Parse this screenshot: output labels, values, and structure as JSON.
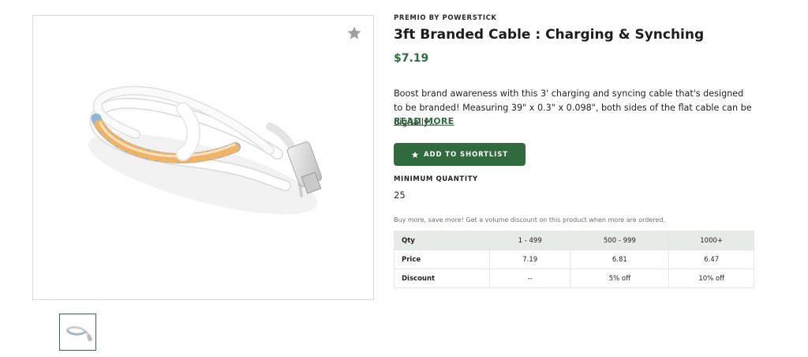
{
  "product": {
    "brand": "PREMIO BY POWERSTICK",
    "title": "3ft Branded Cable : Charging & Synching",
    "price": "$7.19",
    "description": "Boost brand awareness with this 3' charging and syncing cable that's designed to be branded! Measuring 39\" x 0.3\" x 0.098\", both sides of the flat cable can be digitally…",
    "read_more": "READ MORE",
    "shortlist_label": "ADD TO SHORTLIST",
    "min_qty_label": "MINIMUM QUANTITY",
    "min_qty_value": "25",
    "volume_note": "Buy more, save more! Get a volume discount on this product when more are ordered."
  },
  "pricing_table": {
    "headers": [
      "Qty",
      "1 - 499",
      "500 - 999",
      "1000+"
    ],
    "rows": [
      [
        "Price",
        "7.19",
        "6.81",
        "6.47"
      ],
      [
        "Discount",
        "--",
        "5% off",
        "10% off"
      ]
    ]
  },
  "icons": {
    "favorite": "star-icon",
    "shortlist": "star-icon",
    "product_image": "usb-cable-image",
    "thumbnail": "usb-cable-thumbnail"
  },
  "colors": {
    "accent": "#2f6b3c",
    "price": "#2e6b3d",
    "table_header_bg": "#e7ebe7"
  }
}
